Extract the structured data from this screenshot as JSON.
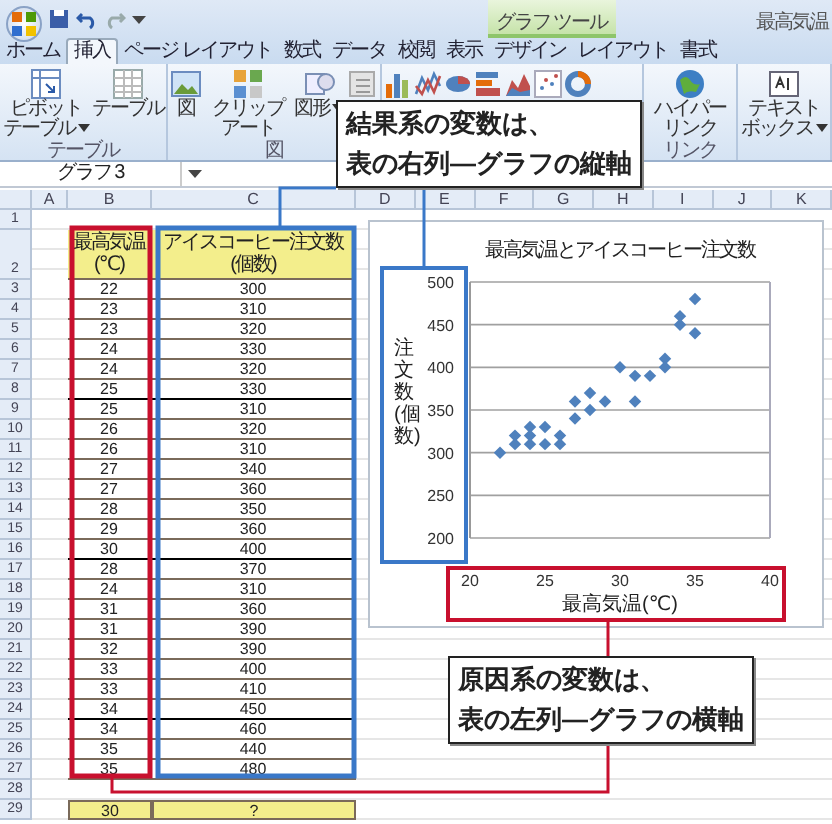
{
  "title_bar": {
    "title": "最高気温"
  },
  "ribbon": {
    "tabs": [
      {
        "label": "ホーム",
        "selected": false
      },
      {
        "label": "挿入",
        "selected": true
      },
      {
        "label": "ページ レイアウト",
        "selected": false
      },
      {
        "label": "数式",
        "selected": false
      },
      {
        "label": "データ",
        "selected": false
      },
      {
        "label": "校閲",
        "selected": false
      },
      {
        "label": "表示",
        "selected": false
      }
    ],
    "context_group": {
      "label": "グラフ ツール",
      "tabs": [
        {
          "label": "デザイン",
          "selected": false
        },
        {
          "label": "レイアウト",
          "selected": false
        },
        {
          "label": "書式",
          "selected": false
        }
      ]
    },
    "groups": [
      {
        "label": "テーブル",
        "buttons": [
          {
            "kind": "pivot",
            "label": "ピボットテーブル",
            "dropdown": true
          },
          {
            "kind": "table",
            "label": "テーブル"
          }
        ]
      },
      {
        "label": "図",
        "buttons": [
          {
            "kind": "picture",
            "label": "図"
          },
          {
            "kind": "clipart",
            "label": "クリップアート"
          },
          {
            "kind": "shapes",
            "label": "図形",
            "dropdown": true
          },
          {
            "kind": "smartart"
          }
        ]
      },
      {
        "buttons": [
          {
            "kind": "column"
          },
          {
            "kind": "line"
          },
          {
            "kind": "pie"
          },
          {
            "kind": "bar"
          },
          {
            "kind": "area"
          },
          {
            "kind": "scatter"
          },
          {
            "kind": "donut"
          }
        ]
      },
      {
        "label": "リンク",
        "buttons": [
          {
            "kind": "globe",
            "label": "ハイパーリンク"
          }
        ]
      },
      {
        "buttons": [
          {
            "kind": "textbox",
            "label": "テキストボックス",
            "dropdown": true
          }
        ]
      }
    ]
  },
  "formula_bar": {
    "name_box": "グラフ 3"
  },
  "sheet": {
    "columns": [
      "A",
      "B",
      "C",
      "D",
      "E",
      "F",
      "G",
      "H",
      "I",
      "J",
      "K"
    ],
    "row_numbers": [
      "1",
      "2",
      "3",
      "4",
      "5",
      "6",
      "7",
      "8",
      "9",
      "10",
      "11",
      "12",
      "13",
      "14",
      "15",
      "16",
      "17",
      "18",
      "19",
      "20",
      "21",
      "22",
      "23",
      "24",
      "25",
      "26",
      "27",
      "28",
      "29"
    ],
    "header": [
      "最高気温(℃)",
      "アイスコーヒー注文数(個数)"
    ],
    "rows": [
      [
        "",
        "22",
        "300"
      ],
      [
        "",
        "23",
        "310"
      ],
      [
        "",
        "23",
        "320"
      ],
      [
        "",
        "24",
        "330"
      ],
      [
        "",
        "24",
        "320"
      ],
      [
        "",
        "25",
        "330"
      ],
      [
        "",
        "25",
        "310"
      ],
      [
        "",
        "26",
        "320"
      ],
      [
        "",
        "26",
        "310"
      ],
      [
        "",
        "27",
        "340"
      ],
      [
        "",
        "27",
        "360"
      ],
      [
        "",
        "28",
        "350"
      ],
      [
        "",
        "29",
        "360"
      ],
      [
        "",
        "30",
        "400"
      ],
      [
        "",
        "28",
        "370"
      ],
      [
        "",
        "24",
        "310"
      ],
      [
        "",
        "31",
        "360"
      ],
      [
        "",
        "31",
        "390"
      ],
      [
        "",
        "32",
        "390"
      ],
      [
        "",
        "33",
        "400"
      ],
      [
        "",
        "33",
        "410"
      ],
      [
        "",
        "34",
        "450"
      ],
      [
        "",
        "34",
        "460"
      ],
      [
        "",
        "35",
        "440"
      ],
      [
        "",
        "35",
        "480"
      ]
    ],
    "footer": [
      "30",
      "?"
    ]
  },
  "chart": {
    "chart_data": {
      "type": "scatter",
      "title": "最高気温とアイスコーヒー注文数",
      "xlabel": "最高気温(℃)",
      "ylabel": "注文数(個数)",
      "grid": true,
      "x": [
        22,
        23,
        23,
        24,
        24,
        25,
        25,
        26,
        26,
        27,
        27,
        28,
        29,
        30,
        28,
        24,
        31,
        31,
        32,
        33,
        33,
        34,
        34,
        35,
        35
      ],
      "series": [
        {
          "color": "#4f81bd",
          "values": [
            300,
            310,
            320,
            330,
            320,
            330,
            310,
            320,
            310,
            340,
            360,
            350,
            360,
            400,
            370,
            310,
            360,
            390,
            390,
            400,
            410,
            450,
            460,
            440,
            480
          ]
        }
      ],
      "xlim": [
        20,
        40
      ],
      "ylim": [
        200,
        500
      ],
      "xticks": [
        20,
        25,
        30,
        35,
        40
      ],
      "yticks": [
        200,
        250,
        300,
        350,
        400,
        450,
        500
      ]
    }
  },
  "callouts": [
    {
      "lines": [
        "結果系の変数は、",
        "表の右列―グラフの縦軸"
      ]
    },
    {
      "lines": [
        "原因系の変数は、",
        "表の左列―グラフの横軸"
      ]
    }
  ]
}
